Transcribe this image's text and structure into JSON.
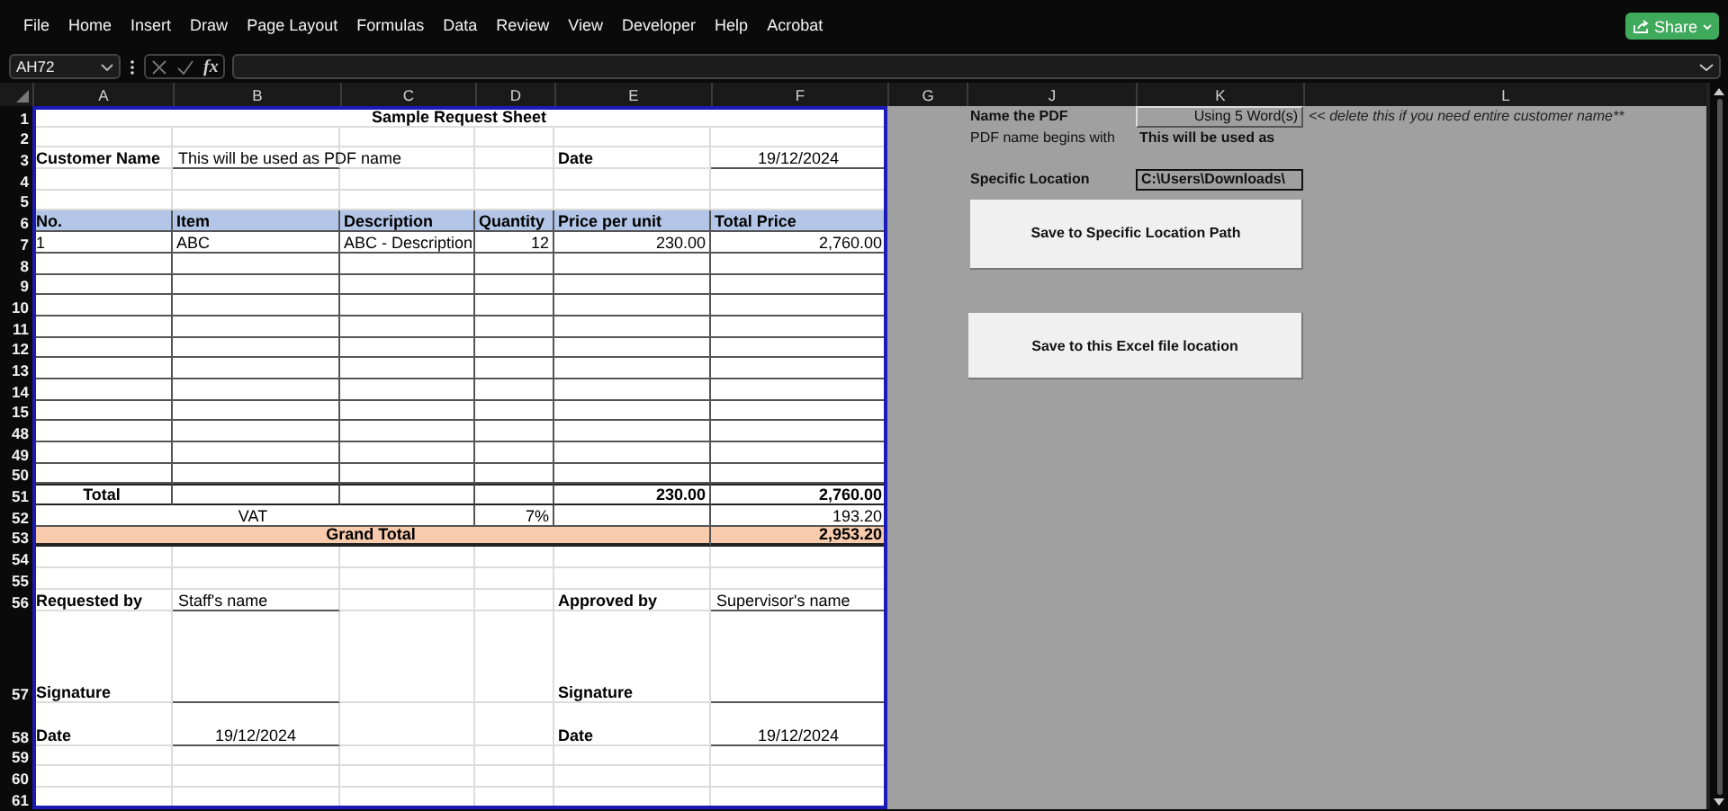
{
  "menu": [
    "File",
    "Home",
    "Insert",
    "Draw",
    "Page Layout",
    "Formulas",
    "Data",
    "Review",
    "View",
    "Developer",
    "Help",
    "Acrobat"
  ],
  "share_button": "Share",
  "formula_bar": {
    "name_box": "AH72",
    "function_label": "fx"
  },
  "columns": [
    "A",
    "B",
    "C",
    "D",
    "E",
    "F",
    "G",
    "J",
    "K",
    "L"
  ],
  "sheet": {
    "rows": [
      {
        "number": "1",
        "kind": "plain",
        "cells": [
          {
            "kind": "title",
            "text": "Sample Request Sheet"
          }
        ]
      },
      {
        "number": "2",
        "kind": "plain"
      },
      {
        "number": "3",
        "kind": "plain",
        "cells": [
          {
            "kind": "label",
            "text": "Customer Name"
          },
          {
            "kind": "line",
            "text": "This will be used as PDF name"
          },
          {
            "kind": "blank"
          },
          {
            "kind": "blank"
          },
          {
            "kind": "label",
            "text": "Date"
          },
          {
            "kind": "line_center",
            "text": "19/12/2024"
          }
        ]
      },
      {
        "number": "4",
        "kind": "plain"
      },
      {
        "number": "5",
        "kind": "plain"
      },
      {
        "number": "6",
        "kind": "table",
        "cells": [
          {
            "kind": "header",
            "text": "No."
          },
          {
            "kind": "header",
            "text": "Item"
          },
          {
            "kind": "header",
            "text": "Description"
          },
          {
            "kind": "header",
            "text": "Quantity"
          },
          {
            "kind": "header",
            "text": "Price per unit"
          },
          {
            "kind": "header",
            "text": "Total Price"
          }
        ]
      },
      {
        "number": "7",
        "kind": "table",
        "cells": [
          {
            "kind": "text",
            "text": "1"
          },
          {
            "kind": "text",
            "text": "ABC"
          },
          {
            "kind": "text",
            "text": "ABC - Description"
          },
          {
            "kind": "number",
            "text": "12"
          },
          {
            "kind": "number",
            "text": "230.00"
          },
          {
            "kind": "number",
            "text": "2,760.00"
          }
        ]
      },
      {
        "number": "8",
        "kind": "table"
      },
      {
        "number": "9",
        "kind": "table"
      },
      {
        "number": "10",
        "kind": "table"
      },
      {
        "number": "11",
        "kind": "table"
      },
      {
        "number": "12",
        "kind": "table"
      },
      {
        "number": "13",
        "kind": "table"
      },
      {
        "number": "14",
        "kind": "table"
      },
      {
        "number": "15",
        "kind": "table"
      },
      {
        "number": "48",
        "kind": "table"
      },
      {
        "number": "49",
        "kind": "table"
      },
      {
        "number": "50",
        "kind": "table"
      },
      {
        "number": "51",
        "kind": "total",
        "cells": [
          {
            "kind": "total_label",
            "text": "Total"
          },
          {
            "kind": "blank"
          },
          {
            "kind": "blank"
          },
          {
            "kind": "blank"
          },
          {
            "kind": "total_number",
            "text": "230.00"
          },
          {
            "kind": "total_number",
            "text": "2,760.00"
          }
        ]
      },
      {
        "number": "52",
        "kind": "table",
        "cells": [
          {
            "kind": "vat_label",
            "text": "VAT"
          },
          {
            "kind": "number",
            "text": "7%"
          },
          {
            "kind": "blank"
          },
          {
            "kind": "number",
            "text": "193.20"
          }
        ]
      },
      {
        "number": "53",
        "kind": "grand",
        "cells": [
          {
            "kind": "grand_label",
            "text": "Grand Total"
          },
          {
            "kind": "grand_number",
            "text": "2,953.20"
          }
        ]
      },
      {
        "number": "54",
        "kind": "plain"
      },
      {
        "number": "55",
        "kind": "plain"
      },
      {
        "number": "56",
        "kind": "plain",
        "cells": [
          {
            "kind": "label",
            "text": "Requested by"
          },
          {
            "kind": "line",
            "text": "Staff's name"
          },
          {
            "kind": "blank"
          },
          {
            "kind": "blank"
          },
          {
            "kind": "label",
            "text": "Approved by"
          },
          {
            "kind": "line",
            "text": "Supervisor's name"
          }
        ]
      },
      {
        "number": "57",
        "kind": "tall",
        "cells": [
          {
            "kind": "label",
            "text": "Signature"
          },
          {
            "kind": "line_blank"
          },
          {
            "kind": "blank"
          },
          {
            "kind": "blank"
          },
          {
            "kind": "label",
            "text": "Signature"
          },
          {
            "kind": "line_blank"
          }
        ]
      },
      {
        "number": "58",
        "kind": "medium",
        "cells": [
          {
            "kind": "label",
            "text": "Date"
          },
          {
            "kind": "line_center",
            "text": "19/12/2024"
          },
          {
            "kind": "blank"
          },
          {
            "kind": "blank"
          },
          {
            "kind": "label",
            "text": "Date"
          },
          {
            "kind": "line_center",
            "text": "19/12/2024"
          }
        ]
      },
      {
        "number": "59",
        "kind": "plain"
      },
      {
        "number": "60",
        "kind": "plain"
      },
      {
        "number": "61",
        "kind": "plain"
      }
    ]
  },
  "pdf_panel": {
    "name_label": "Name the PDF",
    "name_value": "Using 5 Word(s)",
    "name_note": "<< delete this if you need entire customer name**",
    "begins_label": "PDF name begins with",
    "begins_value": "This will be used as",
    "location_label": "Specific Location",
    "location_value": "C:\\Users\\Downloads\\",
    "buttons": [
      "Save to Specific Location Path",
      "Save to this Excel file location"
    ]
  }
}
